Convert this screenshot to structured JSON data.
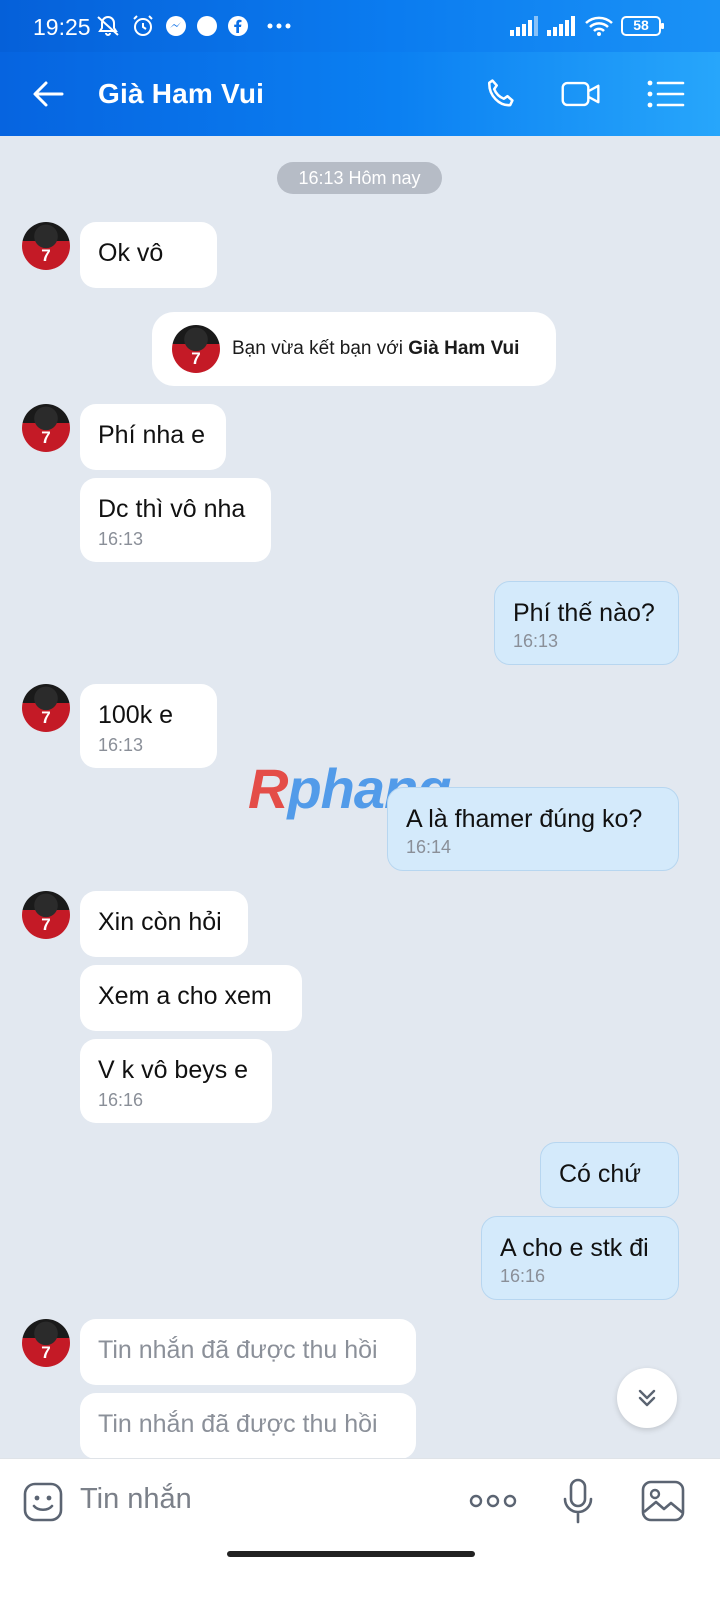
{
  "status_bar": {
    "time": "19:25",
    "battery": "58",
    "icons": [
      "mute-icon",
      "alarm-icon",
      "messenger-icon",
      "dot-icon",
      "facebook-icon",
      "more-icon",
      "signal-icon",
      "signal-icon",
      "wifi-icon",
      "battery-icon"
    ]
  },
  "header": {
    "title": "Già Ham Vui",
    "icons": [
      "back-arrow-icon",
      "phone-icon",
      "video-call-icon",
      "menu-list-icon"
    ]
  },
  "chat": {
    "date_label": "16:13 Hôm nay",
    "system_message": {
      "prefix": "Bạn vừa kết bạn với ",
      "name": "Già Ham Vui"
    },
    "avatar_text": "7",
    "messages": [
      {
        "text": "Ok vô",
        "time": ""
      },
      {
        "text": "Phí nha e",
        "time": ""
      },
      {
        "text": "Dc thì vô nha",
        "time": "16:13"
      },
      {
        "text": "Phí thế nào?",
        "time": "16:13"
      },
      {
        "text": "100k e",
        "time": "16:13"
      },
      {
        "text": "A là fhamer đúng ko?",
        "time": "16:14"
      },
      {
        "text": "Xin còn hỏi",
        "time": ""
      },
      {
        "text": "Xem a cho xem",
        "time": ""
      },
      {
        "text": "V k vô beys e",
        "time": "16:16"
      },
      {
        "text": "Có chứ",
        "time": ""
      },
      {
        "text": "A cho e stk đi",
        "time": "16:16"
      },
      {
        "text": "Tin nhắn đã được thu hồi",
        "time": ""
      },
      {
        "text": "Tin nhắn đã được thu hồi",
        "time": ""
      }
    ],
    "watermark": {
      "r": "R",
      "rest": "phang"
    }
  },
  "composer": {
    "placeholder": "Tin nhắn"
  },
  "colors": {
    "header": "#0b80f2",
    "bubble_sent": "#d4eafb",
    "bubble_received": "#ffffff",
    "background": "#e2e8f0"
  }
}
